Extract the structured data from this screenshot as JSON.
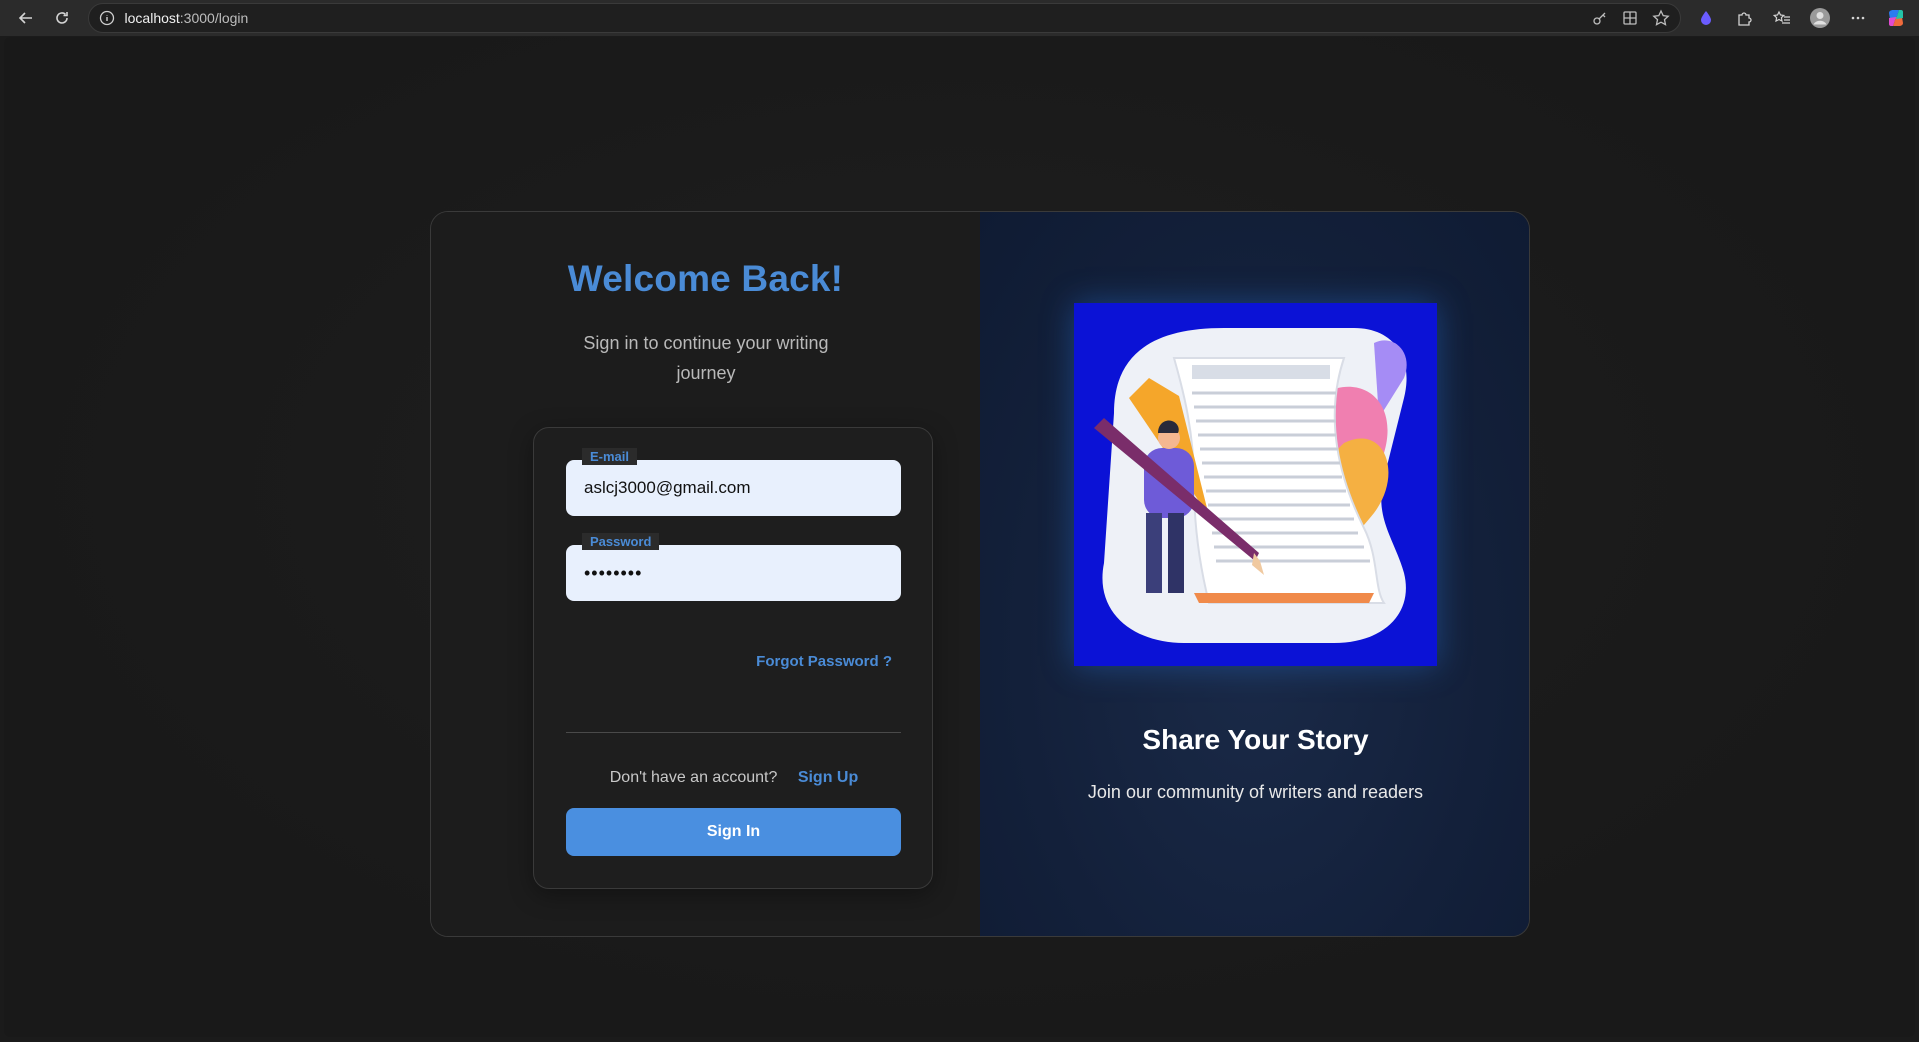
{
  "browser": {
    "url_host": "localhost",
    "url_path": ":3000/login"
  },
  "login": {
    "title": "Welcome Back!",
    "subtitle": "Sign in to continue your writing journey",
    "email_label": "E-mail",
    "email_value": "aslcj3000@gmail.com",
    "password_label": "Password",
    "password_value": "••••••••",
    "forgot_password": "Forgot Password ?",
    "no_account_text": "Don't have an account?",
    "signup_link": "Sign Up",
    "signin_button": "Sign In"
  },
  "promo": {
    "title": "Share Your Story",
    "subtitle": "Join our community of writers and readers"
  },
  "colors": {
    "accent": "#4a8bd6",
    "button": "#4a8fe0",
    "illustration_bg": "#0b12d6"
  }
}
